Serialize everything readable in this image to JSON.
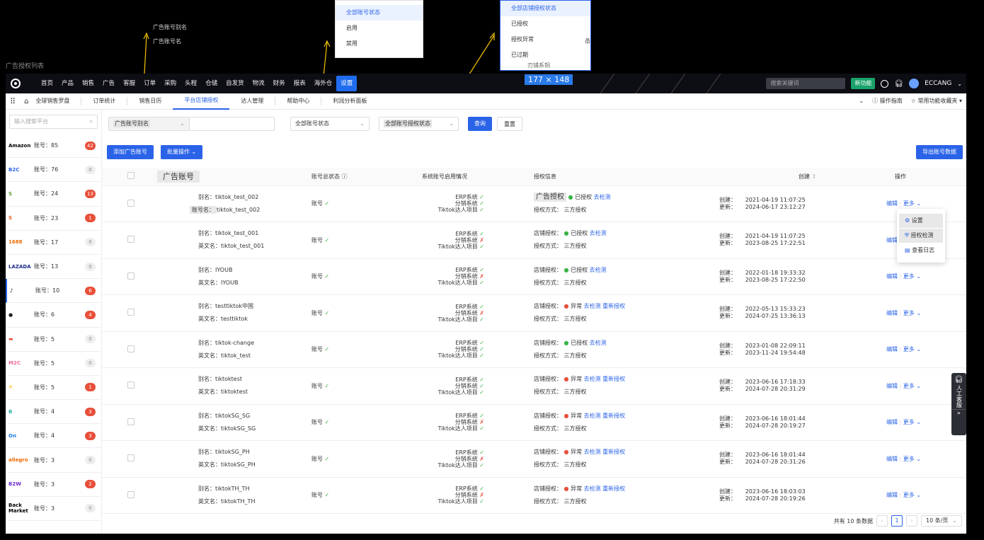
{
  "page_heading": "广告授权列表",
  "annotations": {
    "alias_label": "广告账号别名",
    "name_label": "广告账号名",
    "size_badge": "177 × 148"
  },
  "dropdown_account_status": {
    "items": [
      "全部账号状态",
      "启用",
      "禁用"
    ]
  },
  "dropdown_auth_status": {
    "items": [
      "全部店铺授权状态",
      "已授权",
      "授权异常",
      "已过期"
    ],
    "cut_text": "刃铺系铜",
    "side_cut": "帚"
  },
  "topnav": {
    "items": [
      "首页",
      "产品",
      "销售",
      "广告",
      "客服",
      "订单",
      "采购",
      "头程",
      "仓储",
      "自发货",
      "物流",
      "财务",
      "报表",
      "海外仓",
      "设置"
    ],
    "search_placeholder": "搜索关键词",
    "new_feature": "新功能",
    "user": "ECCANG"
  },
  "tabs": [
    "全球销售罗盘",
    "订单统计",
    "销售日历",
    "平台店铺授权",
    "达人管理",
    "帮助中心",
    "利润分析面板"
  ],
  "tabs_right": {
    "guide": "操作指南",
    "favorites": "常用功能收藏夹"
  },
  "sidebar": {
    "search_placeholder": "输入搜索平台",
    "platforms": [
      {
        "logo": "Amazon",
        "count": "账号：85",
        "badge": "42",
        "hot": true,
        "color": "#000"
      },
      {
        "logo": "B2C",
        "count": "账号：76",
        "badge": "0",
        "hot": false,
        "color": "#2a63e8"
      },
      {
        "logo": "S",
        "count": "账号：24",
        "badge": "13",
        "hot": true,
        "color": "#5a9e2f"
      },
      {
        "logo": "S",
        "count": "账号：23",
        "badge": "1",
        "hot": true,
        "color": "#f05a22"
      },
      {
        "logo": "1688",
        "count": "账号：17",
        "badge": "0",
        "hot": false,
        "color": "#f06a00"
      },
      {
        "logo": "LAZADA",
        "count": "账号：13",
        "badge": "0",
        "hot": false,
        "color": "#1a2a8a"
      },
      {
        "logo": "♪",
        "count": "账号：10",
        "badge": "6",
        "hot": true,
        "color": "#000"
      },
      {
        "logo": "●",
        "count": "账号：6",
        "badge": "4",
        "hot": true,
        "color": "#222"
      },
      {
        "logo": "▬",
        "count": "账号：5",
        "badge": "0",
        "hot": false,
        "color": "#e8503a"
      },
      {
        "logo": "M2C",
        "count": "账号：5",
        "badge": "0",
        "hot": false,
        "color": "#f06a9a"
      },
      {
        "logo": "✳",
        "count": "账号：5",
        "badge": "1",
        "hot": true,
        "color": "#f5b400"
      },
      {
        "logo": "B",
        "count": "账号：4",
        "badge": "3",
        "hot": true,
        "color": "#2ab0a0"
      },
      {
        "logo": "On",
        "count": "账号：4",
        "badge": "3",
        "hot": true,
        "color": "#1a7ae0"
      },
      {
        "logo": "allegro",
        "count": "账号：3",
        "badge": "0",
        "hot": false,
        "color": "#f06a00"
      },
      {
        "logo": "B2W",
        "count": "账号：3",
        "badge": "2",
        "hot": true,
        "color": "#6a2ac8"
      },
      {
        "logo": "Back Market",
        "count": "账号：3",
        "badge": "0",
        "hot": false,
        "color": "#000"
      }
    ]
  },
  "filters": {
    "ad_alias": "广告账号别名",
    "account_status": "全部账号状态",
    "auth_status": "全部账号授权状态",
    "query": "查询",
    "reset": "重置"
  },
  "actions": {
    "add": "添加广告账号",
    "batch": "批量操作",
    "export": "导出账号数据"
  },
  "table": {
    "headers": {
      "account": "广告账号",
      "status": "账号总状态",
      "system": "系统账号启用情况",
      "auth": "授权信息",
      "created": "创建",
      "ops": "操作"
    },
    "sys_labels": [
      "ERP系统",
      "分销系统",
      "Tiktok达人项目"
    ],
    "edit": "编辑",
    "more": "更多",
    "rows": [
      {
        "l1": "别名：",
        "v1": "tiktok_test_002",
        "l2": "账号名：",
        "v2": "tiktok_test_002",
        "status": "账号",
        "sys": [
          true,
          true,
          true
        ],
        "auth_label": "广告授权",
        "auth_state": "已授权",
        "auth_ok": true,
        "links": [
          "去检测"
        ],
        "method": "三方授权",
        "created": "2021-04-19 11:07:25",
        "updated": "2024-06-17 23:12:27"
      },
      {
        "l1": "别名：",
        "v1": "tiktok_test_001",
        "l2": "英文名：",
        "v2": "tiktok_test_001",
        "status": "账号",
        "sys": [
          true,
          false,
          true
        ],
        "auth_label": "店铺授权：",
        "auth_state": "已授权",
        "auth_ok": true,
        "links": [
          "去检测"
        ],
        "method": "三方授权",
        "created": "2021-04-19 11:07:25",
        "updated": "2023-08-25 17:22:51"
      },
      {
        "l1": "别名：",
        "v1": "IYOUB",
        "l2": "英文名：",
        "v2": "IYOUB",
        "status": "账号",
        "sys": [
          true,
          false,
          true
        ],
        "auth_label": "店铺授权：",
        "auth_state": "已授权",
        "auth_ok": true,
        "links": [
          "去检测"
        ],
        "method": "三方授权",
        "created": "2022-01-18 19:33:32",
        "updated": "2023-08-25 17:22:50"
      },
      {
        "l1": "别名：",
        "v1": "testtiktok中国",
        "l2": "英文名：",
        "v2": "testtiktok",
        "status": "账号",
        "sys": [
          true,
          false,
          true
        ],
        "auth_label": "店铺授权：",
        "auth_state": "异常",
        "auth_ok": false,
        "links": [
          "去检测",
          "重新授权"
        ],
        "method": "三方授权",
        "created": "2022-05-13 15:33:23",
        "updated": "2024-07-25 13:36:13"
      },
      {
        "l1": "别名：",
        "v1": "tiktok-change",
        "l2": "英文名：",
        "v2": "tiktok_test",
        "status": "账号",
        "sys": [
          true,
          true,
          true
        ],
        "auth_label": "店铺授权：",
        "auth_state": "已授权",
        "auth_ok": true,
        "links": [
          "去检测"
        ],
        "method": "三方授权",
        "created": "2023-01-08 22:09:11",
        "updated": "2023-11-24 19:54:48"
      },
      {
        "l1": "别名：",
        "v1": "tiktoktest",
        "l2": "英文名：",
        "v2": "tiktoktest",
        "status": "账号",
        "sys": [
          true,
          true,
          true
        ],
        "auth_label": "店铺授权：",
        "auth_state": "异常",
        "auth_ok": false,
        "links": [
          "去检测",
          "重新授权"
        ],
        "method": "三方授权",
        "created": "2023-06-16 17:18:33",
        "updated": "2024-07-28 20:31:29"
      },
      {
        "l1": "别名：",
        "v1": "tiktokSG_SG",
        "l2": "英文名：",
        "v2": "tiktokSG_SG",
        "status": "账号",
        "sys": [
          true,
          false,
          true
        ],
        "auth_label": "店铺授权：",
        "auth_state": "异常",
        "auth_ok": false,
        "links": [
          "去检测",
          "重新授权"
        ],
        "method": "三方授权",
        "created": "2023-06-16 18:01:44",
        "updated": "2024-07-28 20:19:27"
      },
      {
        "l1": "别名：",
        "v1": "tiktokSG_PH",
        "l2": "英文名：",
        "v2": "tiktokSG_PH",
        "status": "账号",
        "sys": [
          true,
          false,
          true
        ],
        "auth_label": "店铺授权：",
        "auth_state": "异常",
        "auth_ok": false,
        "links": [
          "去检测",
          "重新授权"
        ],
        "method": "三方授权",
        "created": "2023-06-16 18:01:44",
        "updated": "2024-07-28 20:31:26"
      },
      {
        "l1": "别名：",
        "v1": "tiktokTH_TH",
        "l2": "英文名：",
        "v2": "tiktokTH_TH",
        "status": "账号",
        "sys": [
          true,
          false,
          true
        ],
        "auth_label": "店铺授权：",
        "auth_state": "异常",
        "auth_ok": false,
        "links": [
          "去检测",
          "重新授权"
        ],
        "method": "三方授权",
        "created": "2023-06-16 18:03:03",
        "updated": "2024-07-28 20:19:26"
      }
    ],
    "auth_method_label": "授权方式：",
    "created_label": "创建：",
    "updated_label": "更新："
  },
  "more_menu": [
    "设置",
    "授权检测",
    "查看日志"
  ],
  "pager": {
    "total": "共有 10 条数据",
    "page": "1",
    "size": "10 条/页"
  },
  "customer_service": "人工客服"
}
